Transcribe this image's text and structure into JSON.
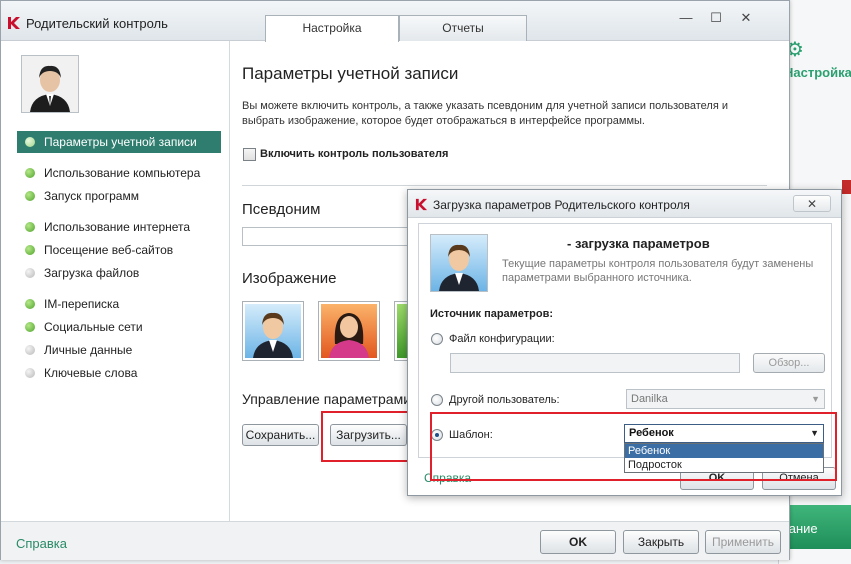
{
  "background_app": {
    "settings_label": "Настройка",
    "green_bar_label": "вание"
  },
  "window": {
    "title": "Родительский контроль",
    "tabs": [
      {
        "label": "Настройка",
        "active": true
      },
      {
        "label": "Отчеты",
        "active": false
      }
    ],
    "controls": {
      "minimize": "—",
      "maximize": "☐",
      "close": "✕"
    }
  },
  "sidebar": {
    "items": [
      {
        "label": "Параметры учетной записи",
        "status": "active"
      },
      {
        "label": "Использование компьютера",
        "status": "on"
      },
      {
        "label": "Запуск программ",
        "status": "on"
      },
      {
        "label": "Использование интернета",
        "status": "on"
      },
      {
        "label": "Посещение веб-сайтов",
        "status": "on"
      },
      {
        "label": "Загрузка файлов",
        "status": "off"
      },
      {
        "label": "IM-переписка",
        "status": "on"
      },
      {
        "label": "Социальные сети",
        "status": "on"
      },
      {
        "label": "Личные данные",
        "status": "off"
      },
      {
        "label": "Ключевые слова",
        "status": "off"
      }
    ]
  },
  "content": {
    "heading": "Параметры учетной записи",
    "description": "Вы можете включить контроль, а также указать псевдоним для учетной записи пользователя и выбрать изображение, которое будет отображаться в интерфейсе программы.",
    "enable_checkbox_label": "Включить контроль пользователя",
    "nickname_title": "Псевдоним",
    "image_title": "Изображение",
    "manage_title": "Управление параметрами",
    "save_button": "Сохранить...",
    "load_button": "Загрузить..."
  },
  "footer": {
    "help": "Справка",
    "ok": "OK",
    "close": "Закрыть",
    "apply": "Применить"
  },
  "dialog": {
    "title": "Загрузка параметров Родительского контроля",
    "heading": "- загрузка параметров",
    "description": "Текущие параметры контроля пользователя будут заменены параметрами выбранного источника.",
    "source_label": "Источник параметров:",
    "config_file_label": "Файл конфигурации:",
    "browse_button": "Обзор...",
    "other_user_label": "Другой пользователь:",
    "other_user_value": "Danilka",
    "template_label": "Шаблон:",
    "template_selected": "Ребенок",
    "template_options": [
      "Ребенок",
      "Подросток"
    ],
    "help": "Справка",
    "ok": "OK",
    "cancel": "Отмена",
    "close": "✕"
  },
  "colors": {
    "accent_green": "#2e7d6f",
    "link_green": "#2a8a66",
    "highlight_red": "#e0202a"
  }
}
